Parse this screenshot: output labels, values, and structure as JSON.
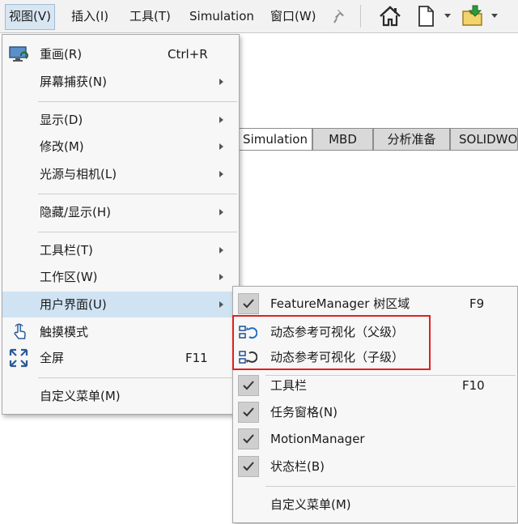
{
  "menubar": {
    "items": [
      {
        "label": "视图(V)"
      },
      {
        "label": "插入(I)"
      },
      {
        "label": "工具(T)"
      },
      {
        "label": "Simulation"
      },
      {
        "label": "窗口(W)"
      }
    ],
    "tool_icons": [
      "pin-icon",
      "home-icon",
      "new-document-icon",
      "open-document-icon"
    ]
  },
  "tabs": [
    {
      "label": "Simulation"
    },
    {
      "label": "MBD"
    },
    {
      "label": "分析准备"
    },
    {
      "label": "SOLIDWO"
    }
  ],
  "view_menu": {
    "items": [
      {
        "label": "重画(R)",
        "shortcut": "Ctrl+R",
        "icon": "redraw-monitor-icon"
      },
      {
        "label": "屏幕捕获(N)",
        "submenu": true
      },
      {
        "label": "显示(D)",
        "submenu": true
      },
      {
        "label": "修改(M)",
        "submenu": true
      },
      {
        "label": "光源与相机(L)",
        "submenu": true
      },
      {
        "label": "隐藏/显示(H)",
        "submenu": true
      },
      {
        "label": "工具栏(T)",
        "submenu": true
      },
      {
        "label": "工作区(W)",
        "submenu": true
      },
      {
        "label": "用户界面(U)",
        "submenu": true,
        "highlighted": true
      },
      {
        "label": "触摸模式",
        "icon": "touch-hand-icon"
      },
      {
        "label": "全屏",
        "shortcut": "F11",
        "icon": "fullscreen-icon"
      },
      {
        "label": "自定义菜单(M)"
      }
    ]
  },
  "ui_submenu": {
    "items": [
      {
        "label": "FeatureManager 树区域",
        "shortcut": "F9",
        "checked": true
      },
      {
        "label": "动态参考可视化（父级）",
        "icon": "dynamic-reference-parent-icon",
        "boxed": true
      },
      {
        "label": "动态参考可视化（子级）",
        "icon": "dynamic-reference-child-icon",
        "boxed": true
      },
      {
        "label": "工具栏",
        "shortcut": "F10",
        "checked": true
      },
      {
        "label": "任务窗格(N)",
        "checked": true
      },
      {
        "label": "MotionManager",
        "checked": true
      },
      {
        "label": "状态栏(B)",
        "checked": true
      },
      {
        "label": "自定义菜单(M)"
      }
    ]
  },
  "colors": {
    "menu_bg": "#f7f7f7",
    "highlight": "#cfe3f3",
    "annotation_red": "#e02020",
    "tab_bg": "#d9d9d9"
  }
}
